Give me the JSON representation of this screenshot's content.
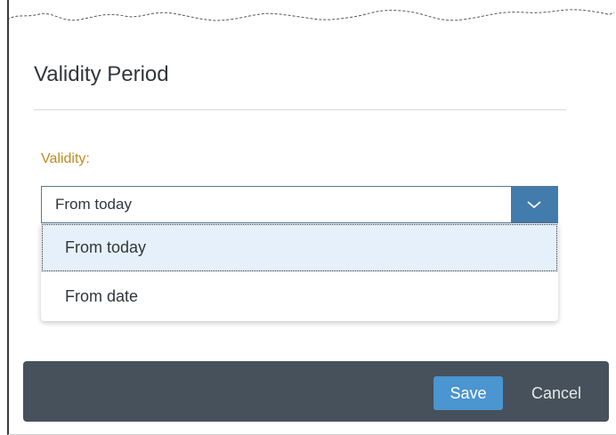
{
  "dialog": {
    "title": "Validity Period",
    "field_label": "Validity:",
    "select": {
      "value": "From today",
      "options": [
        "From today",
        "From date"
      ],
      "selected_index": 0,
      "button_icon": "chevron-down-icon"
    },
    "footer": {
      "save_label": "Save",
      "cancel_label": "Cancel"
    }
  },
  "colors": {
    "label": "#c28a21",
    "select_button": "#427cac",
    "selected_item": "#e5f0fa",
    "footer_bar": "#46515b",
    "save_button": "#4b95d0"
  }
}
